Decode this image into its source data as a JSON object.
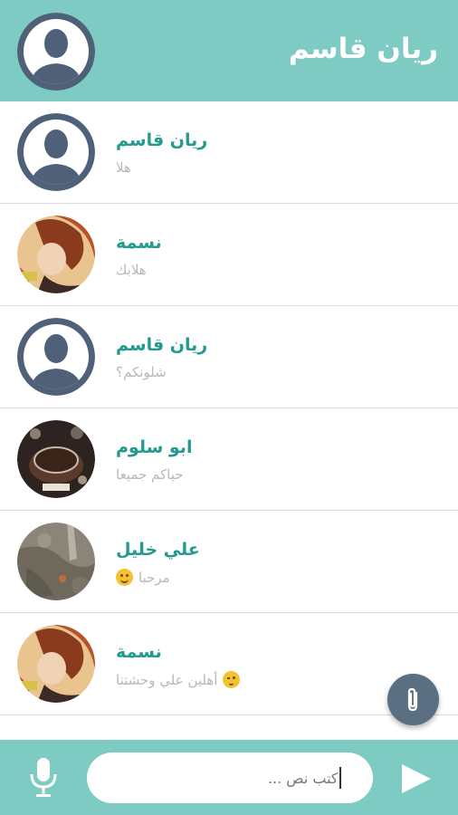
{
  "header": {
    "title": "ريان قاسم",
    "avatar": "default-user-avatar"
  },
  "messages": [
    {
      "name": "ريان قاسم",
      "preview": "هلا",
      "avatar": "default-user-avatar",
      "emoji": ""
    },
    {
      "name": "نسمة",
      "preview": "هلابك",
      "avatar": "photo-avatar",
      "emoji": ""
    },
    {
      "name": "ريان قاسم",
      "preview": "شلونكم؟",
      "avatar": "default-user-avatar",
      "emoji": ""
    },
    {
      "name": "ابو سلوم",
      "preview": "حياكم جميعا",
      "avatar": "photo-avatar",
      "emoji": ""
    },
    {
      "name": "علي خليل",
      "preview": "مرحبا",
      "avatar": "photo-avatar",
      "emoji": "smiling-face"
    },
    {
      "name": "نسمة",
      "preview": "أهلين علي وحشتنا",
      "avatar": "photo-avatar",
      "emoji": "winking-face"
    }
  ],
  "composer": {
    "placeholder": "اكتب نص ...",
    "mic_icon": "microphone-icon",
    "send_icon": "send-icon",
    "attach_icon": "paperclip-icon"
  },
  "colors": {
    "primary": "#7ecbc4",
    "accent": "#239a8d",
    "avatar_default": "#4f6079",
    "fab": "#5a6f82"
  }
}
